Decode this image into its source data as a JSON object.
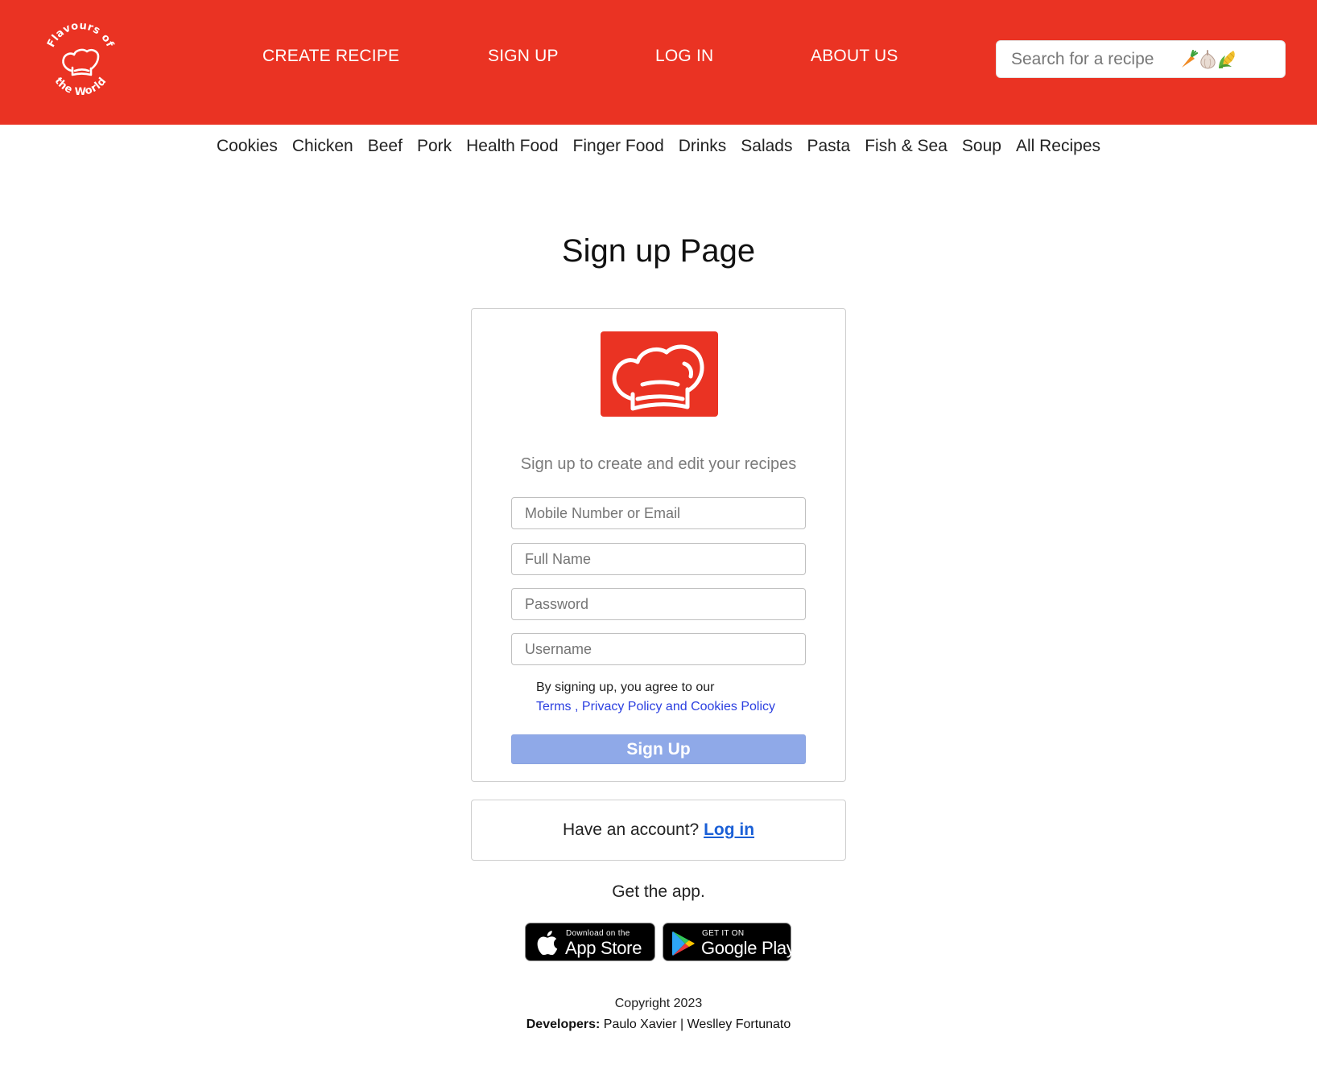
{
  "header": {
    "logo_text_top": "Flavours of",
    "logo_text_bottom": "the World",
    "nav": {
      "create_recipe": "CREATE RECIPE",
      "sign_up": "SIGN UP",
      "log_in": "LOG IN",
      "about_us": "ABOUT US"
    },
    "search_placeholder": "Search for a recipe",
    "search_icons": [
      "carrot-icon",
      "garlic-icon",
      "corn-icon"
    ]
  },
  "categories": [
    "Cookies",
    "Chicken",
    "Beef",
    "Pork",
    "Health Food",
    "Finger Food",
    "Drinks",
    "Salads",
    "Pasta",
    "Fish & Sea",
    "Soup",
    "All Recipes"
  ],
  "page_title": "Sign up Page",
  "signup_card": {
    "logo_icon": "chef-hat-icon",
    "subtitle": "Sign up to create and edit your recipes",
    "fields": {
      "contact_placeholder": "Mobile Number or Email",
      "fullname_placeholder": "Full Name",
      "password_placeholder": "Password",
      "username_placeholder": "Username"
    },
    "terms_intro": "By signing up, you agree to our",
    "terms_link": "Terms ,",
    "privacy_link": "Privacy Policy and Cookies Policy",
    "submit_label": "Sign Up"
  },
  "login_card": {
    "prompt": "Have an account?",
    "link": "Log in"
  },
  "app": {
    "title": "Get the app.",
    "apple_small": "Download on the",
    "apple_big": "App Store",
    "google_small": "GET IT ON",
    "google_big": "Google Play"
  },
  "footer": {
    "copyright": "Copyright 2023",
    "developers_label": "Developers:",
    "developer_1": "Paulo Xavier",
    "separator": "|",
    "developer_2": "Weslley Fortunato"
  },
  "colors": {
    "brand_red": "#EA3323",
    "button_blue": "#8FA9E8",
    "link_blue": "#1a5fd6"
  }
}
